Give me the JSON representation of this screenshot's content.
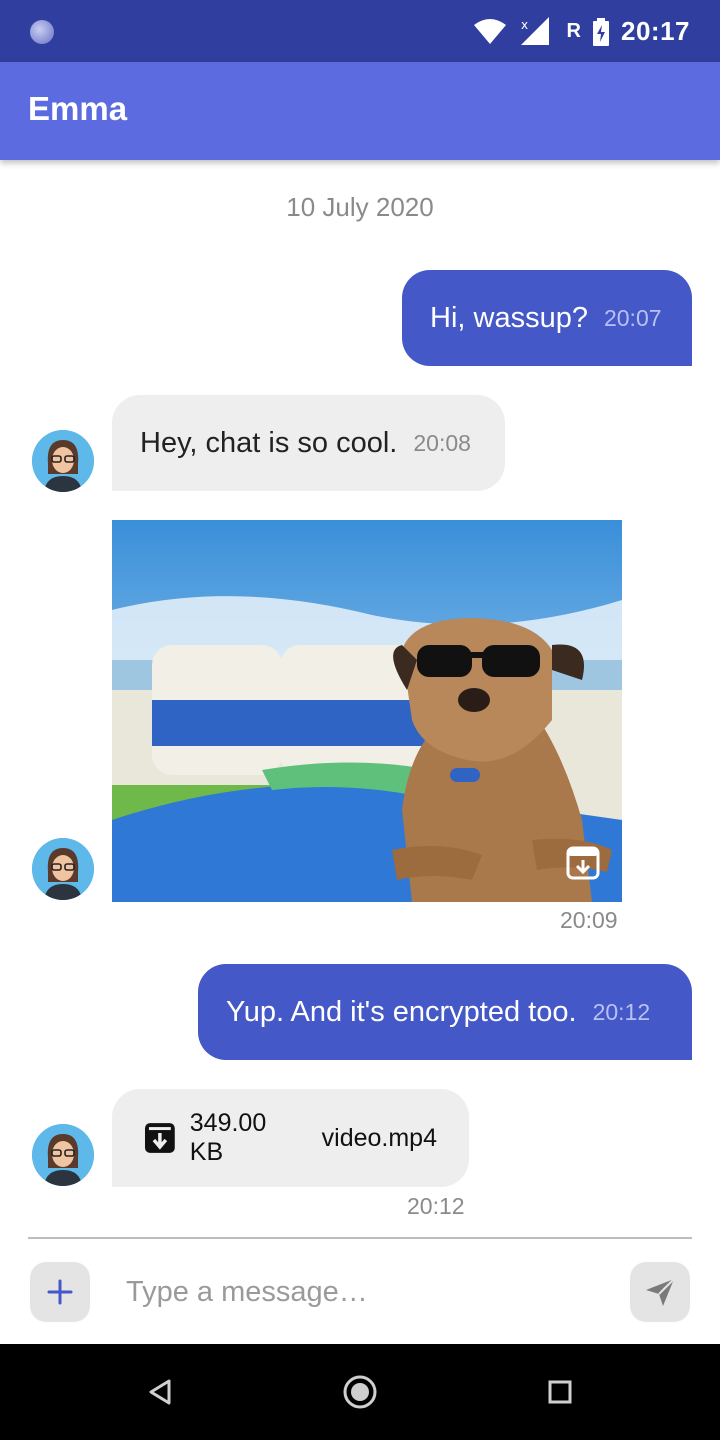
{
  "status_bar": {
    "time": "20:17",
    "roaming": "R",
    "icons": [
      "notification-dot-icon",
      "wifi-icon",
      "signal-icon",
      "battery-charging-icon"
    ]
  },
  "app_bar": {
    "title": "Emma"
  },
  "chat": {
    "date_separator": "10 July 2020",
    "messages": [
      {
        "direction": "outgoing",
        "text": "Hi, wassup?",
        "time": "20:07"
      },
      {
        "direction": "incoming",
        "text": "Hey, chat is so cool.",
        "time": "20:08"
      },
      {
        "direction": "incoming",
        "type": "image",
        "time": "20:09",
        "icon": "download-icon"
      },
      {
        "direction": "outgoing",
        "text": "Yup. And it's encrypted too.",
        "time": "20:12"
      },
      {
        "direction": "incoming",
        "type": "file",
        "file_size": "349.00 KB",
        "file_name": "video.mp4",
        "time": "20:12",
        "icon": "download-icon"
      }
    ]
  },
  "composer": {
    "placeholder": "Type a message…",
    "attach_icon": "plus-icon",
    "send_icon": "send-icon"
  },
  "nav_bar": {
    "icons": [
      "back-icon",
      "home-icon",
      "recents-icon"
    ]
  },
  "colors": {
    "status_bar": "#303F9F",
    "app_bar": "#5C6BDF",
    "outgoing_bubble": "#4458C8",
    "incoming_bubble": "#EEEEEE"
  }
}
